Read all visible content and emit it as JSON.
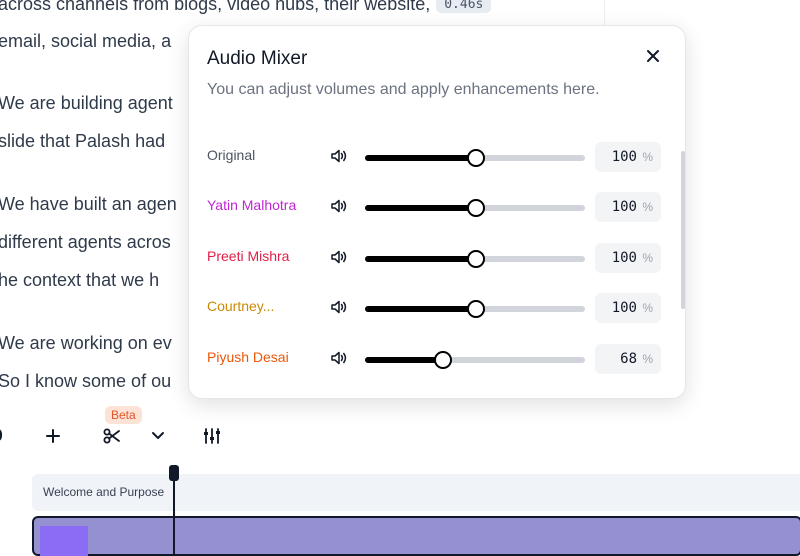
{
  "transcript": {
    "lines": [
      {
        "text": "across channels from blogs, video hubs, their website,",
        "chip": "0.46s"
      },
      {
        "text": "email, social media, a",
        "chip": ""
      },
      {
        "text": "We are building agent",
        "chip": ""
      },
      {
        "text": "slide that Palash had",
        "chip": ""
      },
      {
        "text": "We have built an agen",
        "chip": ""
      },
      {
        "text": "different agents acros",
        "chip": ""
      },
      {
        "text": "he context that we h",
        "chip": ""
      },
      {
        "text": "We are working on ev",
        "chip": ""
      },
      {
        "text": "So I know some of ou",
        "chip": ""
      }
    ]
  },
  "toolbar": {
    "add_icon": "plus-icon",
    "split_icon": "scissors-icon",
    "more_icon": "chevron-down-icon",
    "mixer_icon": "sliders-icon",
    "beta_label": "Beta"
  },
  "timeline": {
    "chapter_label": "Welcome and Purpose"
  },
  "mixer": {
    "title": "Audio Mixer",
    "subtitle": "You can adjust volumes and apply enhancements here.",
    "close_icon": "close-icon",
    "unit": "%",
    "tracks": [
      {
        "name": "Original",
        "value": 100,
        "level": 0.5,
        "color": "#4b5563"
      },
      {
        "name": "Yatin Malhotra",
        "value": 100,
        "level": 0.5,
        "color": "#c026d3"
      },
      {
        "name": "Preeti Mishra",
        "value": 100,
        "level": 0.5,
        "color": "#e11d48"
      },
      {
        "name": "Courtney...",
        "value": 100,
        "level": 0.5,
        "color": "#ca8a04"
      },
      {
        "name": "Piyush Desai",
        "value": 68,
        "level": 0.35,
        "color": "#ea580c"
      }
    ]
  }
}
